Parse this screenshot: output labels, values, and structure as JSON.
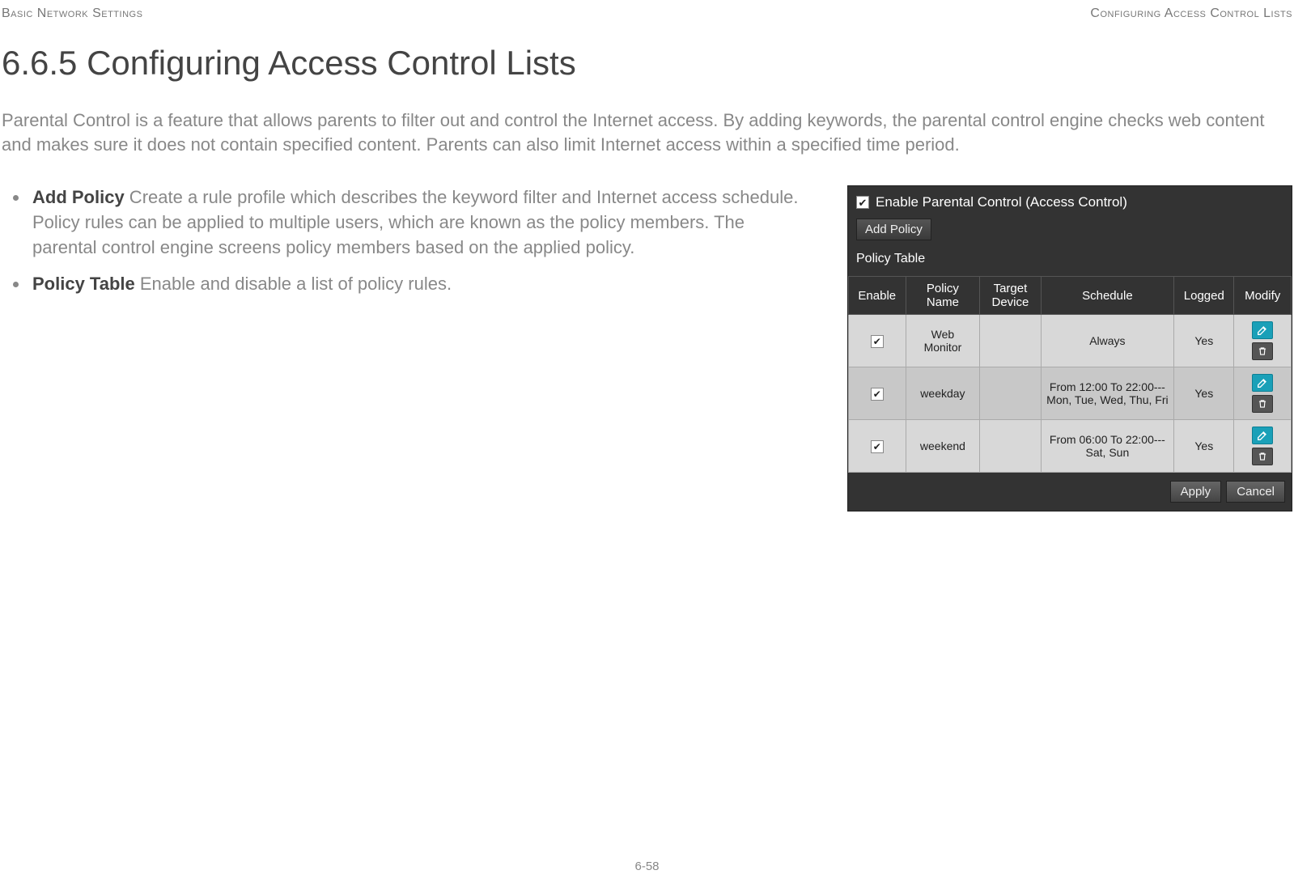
{
  "header": {
    "left": "Basic Network Settings",
    "right": "Configuring Access Control Lists"
  },
  "title": "6.6.5 Configuring Access Control Lists",
  "intro": "Parental Control is a feature that allows parents to filter out and control the Internet access. By adding keywords, the parental control engine checks web content and makes sure it does not contain specified content. Parents can also limit Internet access within a specified time period.",
  "bullets": {
    "add_policy": {
      "lead": "Add Policy",
      "text": "  Create a rule profile which describes the keyword filter and Internet access schedule. Policy rules can be applied to multiple users, which are known as the policy members. The parental control engine screens policy members based on the applied policy."
    },
    "policy_table": {
      "lead": "Policy Table",
      "text": "  Enable and disable a list of policy rules."
    }
  },
  "panel": {
    "enable_label": "Enable Parental Control (Access Control)",
    "enable_checked": "✔",
    "add_policy_btn": "Add Policy",
    "table_label": "Policy Table",
    "columns": {
      "enable": "Enable",
      "policy_name": "Policy Name",
      "target_device": "Target Device",
      "schedule": "Schedule",
      "logged": "Logged",
      "modify": "Modify"
    },
    "rows": [
      {
        "enabled": "✔",
        "name": "Web Monitor",
        "target": "",
        "schedule": "Always",
        "logged": "Yes"
      },
      {
        "enabled": "✔",
        "name": "weekday",
        "target": "",
        "schedule": "From 12:00 To 22:00---Mon, Tue, Wed, Thu, Fri",
        "logged": "Yes"
      },
      {
        "enabled": "✔",
        "name": "weekend",
        "target": "",
        "schedule": "From 06:00 To 22:00---Sat, Sun",
        "logged": "Yes"
      }
    ],
    "apply_btn": "Apply",
    "cancel_btn": "Cancel"
  },
  "page_number": "6-58"
}
